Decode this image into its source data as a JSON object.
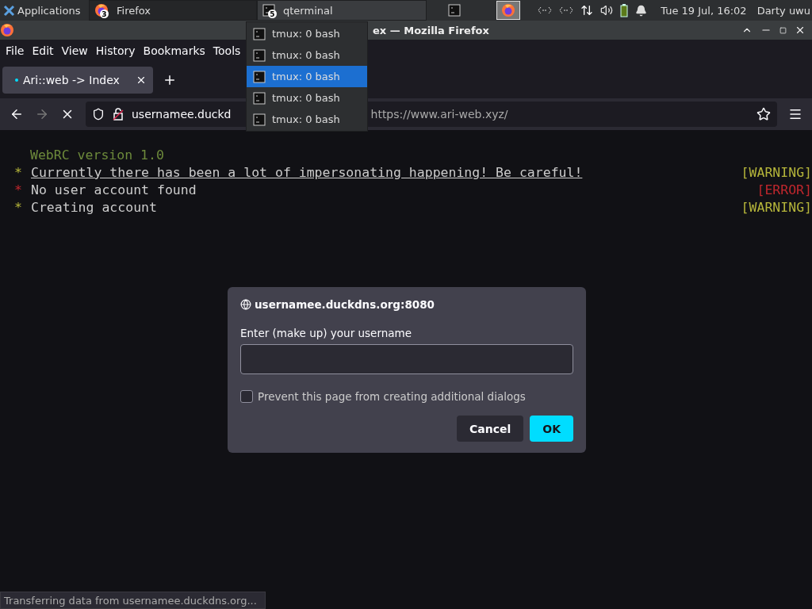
{
  "taskbar": {
    "apps_label": "Applications",
    "tasks": [
      {
        "label": "Firefox",
        "badge": "3",
        "kind": "firefox",
        "selected": false
      },
      {
        "label": "qterminal",
        "badge": "5",
        "kind": "terminal",
        "selected": true
      }
    ],
    "workspaces": [
      {
        "kind": "terminal",
        "selected": false
      },
      {
        "kind": "firefox",
        "selected": true
      }
    ],
    "clock": "Tue 19 Jul, 16:02",
    "user": "Darty uwu"
  },
  "task_menu": {
    "items": [
      {
        "label": "tmux: 0 bash",
        "selected": false
      },
      {
        "label": "tmux: 0 bash",
        "selected": false
      },
      {
        "label": "tmux: 0 bash",
        "selected": true
      },
      {
        "label": "tmux: 0 bash",
        "selected": false
      },
      {
        "label": "tmux: 0 bash",
        "selected": false
      }
    ]
  },
  "window": {
    "title": "ex — Mozilla Firefox"
  },
  "menu_bar": [
    "File",
    "Edit",
    "View",
    "History",
    "Bookmarks",
    "Tools"
  ],
  "tabs": [
    {
      "label": "Ari::web -> Index",
      "selected": true
    }
  ],
  "address_bar": {
    "host": "usernamee.duckd",
    "url": "https://www.ari-web.xyz/"
  },
  "console": {
    "title": "WebRC version 1.0",
    "lines": [
      {
        "bullet": "*",
        "text": "Currently there has been a lot of impersonating happening! Be careful!",
        "tag": "[WARNING]",
        "kind": "warning",
        "underline": true
      },
      {
        "bullet": "*",
        "text": "No user account found",
        "tag": "[ERROR]",
        "kind": "error",
        "underline": false
      },
      {
        "bullet": "*",
        "text": "Creating account",
        "tag": "[WARNING]",
        "kind": "warning",
        "underline": false
      }
    ]
  },
  "dialog": {
    "origin": "usernamee.duckdns.org:8080",
    "prompt": "Enter (make up) your username",
    "checkbox": {
      "label": "Prevent this page from creating additional dialogs",
      "checked": false
    },
    "buttons": [
      {
        "label": "Cancel",
        "kind": "secondary"
      },
      {
        "label": "OK",
        "kind": "primary"
      }
    ]
  },
  "status_bar": "Transferring data from usernamee.duckdns.org..."
}
